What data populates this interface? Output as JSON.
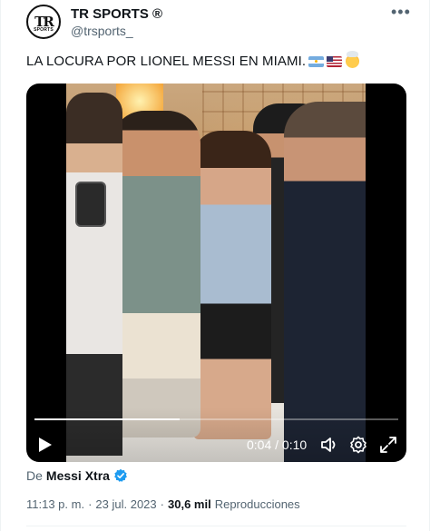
{
  "author": {
    "avatar_monogram": "TR",
    "avatar_sub": "SPORTS",
    "name": "TR SPORTS ®",
    "handle": "@trsports_"
  },
  "tweet_text": "LA LOCURA POR LIONEL MESSI EN MIAMI.",
  "emojis": [
    "flag-argentina",
    "flag-united-states",
    "exploding-head"
  ],
  "video": {
    "progress": 0.4,
    "time_label": "0:04 / 0:10",
    "controls": [
      "play-icon",
      "volume-icon",
      "settings-icon",
      "fullscreen-icon"
    ]
  },
  "source": {
    "prefix": "De",
    "name": "Messi Xtra",
    "verified": true
  },
  "meta": {
    "time": "11:13 p. m.",
    "sep1": "·",
    "date": "23 jul. 2023",
    "sep2": "·",
    "views": "30,6 mil",
    "views_label": "Reproducciones"
  },
  "colors": {
    "text_primary": "#0f1419",
    "text_secondary": "#536471",
    "verified_blue": "#1d9bf0"
  }
}
